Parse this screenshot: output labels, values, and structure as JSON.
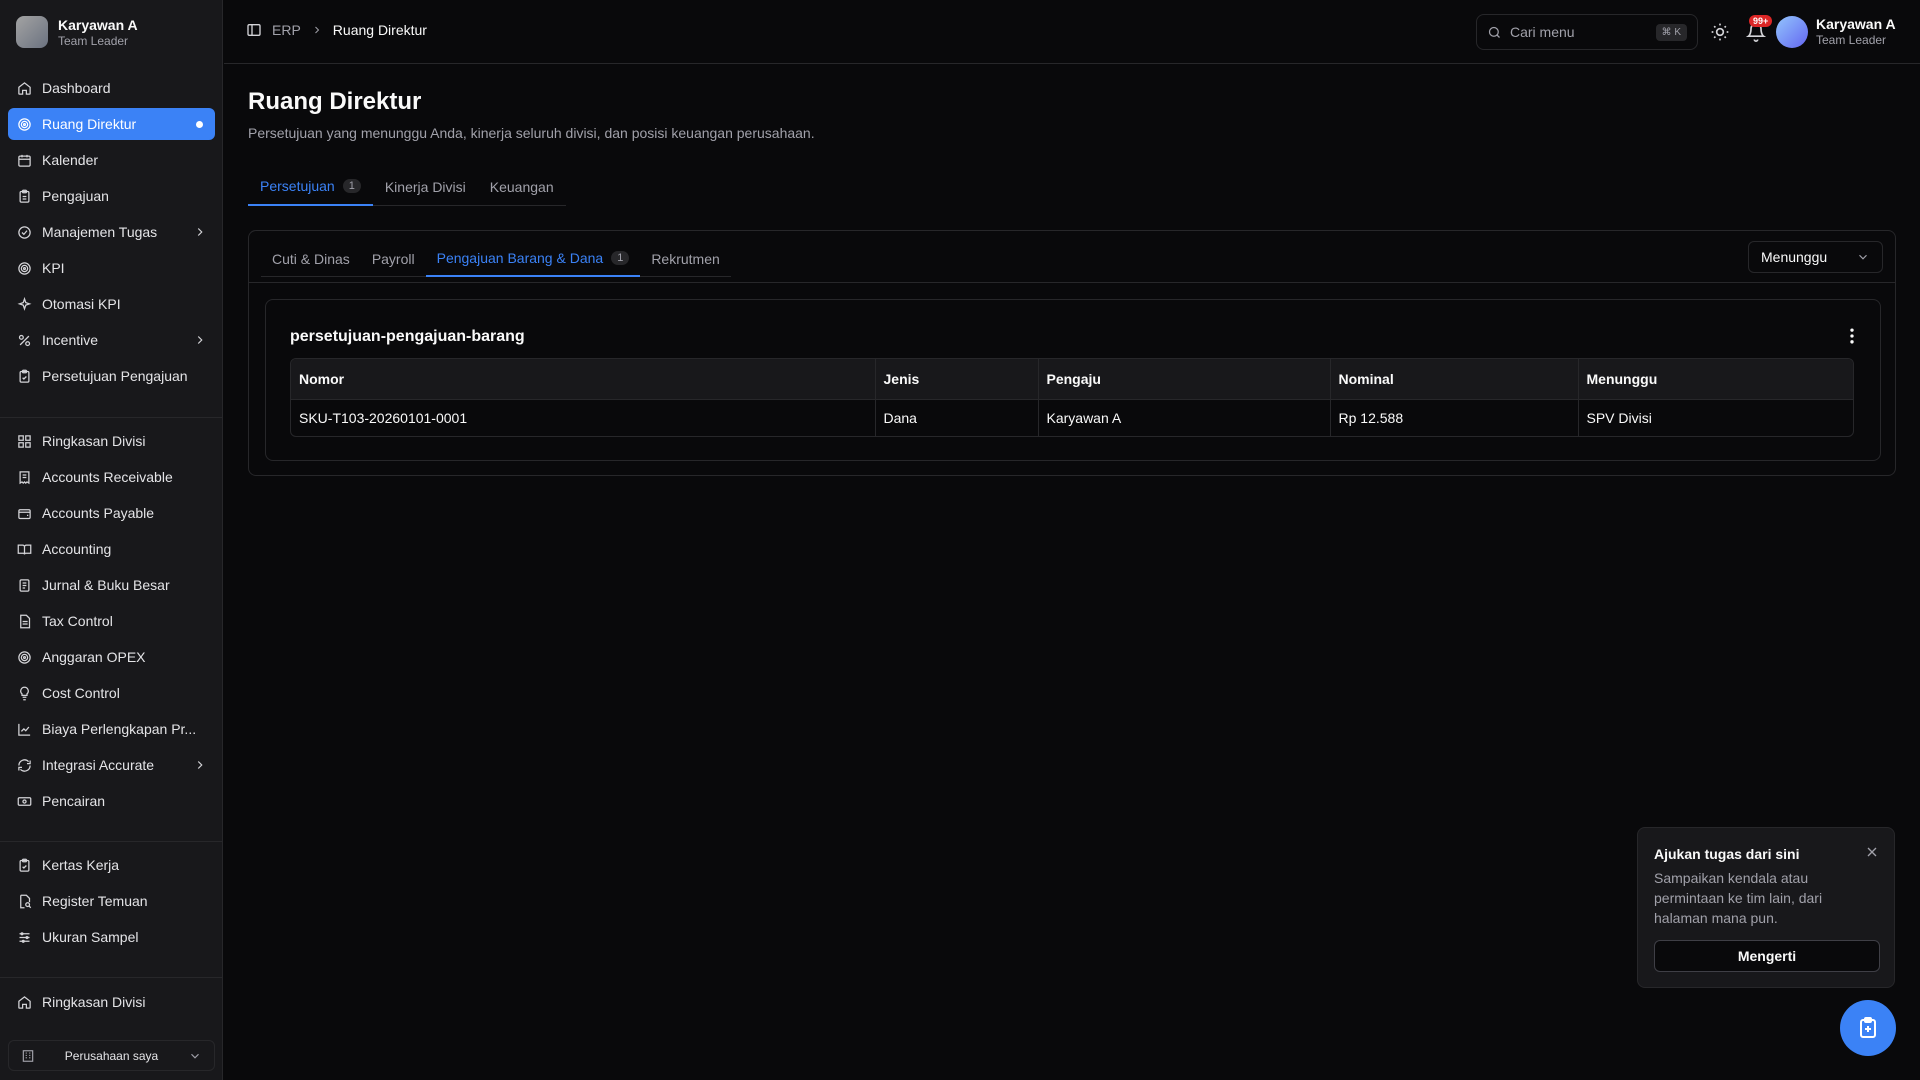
{
  "user": {
    "name": "Karyawan A",
    "role": "Team Leader"
  },
  "sidebar": {
    "group1": [
      {
        "label": "Dashboard",
        "icon": "home-icon"
      },
      {
        "label": "Ruang Direktur",
        "icon": "target-icon",
        "active": true
      },
      {
        "label": "Kalender",
        "icon": "calendar-icon"
      },
      {
        "label": "Pengajuan",
        "icon": "clipboard-icon"
      },
      {
        "label": "Manajemen Tugas",
        "icon": "tasks-icon",
        "chevron": true
      },
      {
        "label": "KPI",
        "icon": "target-icon"
      },
      {
        "label": "Otomasi KPI",
        "icon": "sparkle-icon"
      },
      {
        "label": "Incentive",
        "icon": "percent-icon",
        "chevron": true
      },
      {
        "label": "Persetujuan Pengajuan",
        "icon": "clipboard-check-icon"
      }
    ],
    "group2": [
      {
        "label": "Ringkasan Divisi",
        "icon": "grid-icon"
      },
      {
        "label": "Accounts Receivable",
        "icon": "receipt-icon"
      },
      {
        "label": "Accounts Payable",
        "icon": "wallet-icon"
      },
      {
        "label": "Accounting",
        "icon": "book-icon"
      },
      {
        "label": "Jurnal & Buku Besar",
        "icon": "ledger-icon"
      },
      {
        "label": "Tax Control",
        "icon": "file-text-icon"
      },
      {
        "label": "Anggaran OPEX",
        "icon": "target-icon"
      },
      {
        "label": "Cost Control",
        "icon": "lightbulb-icon"
      },
      {
        "label": "Biaya Perlengkapan Pr...",
        "icon": "chart-icon"
      },
      {
        "label": "Integrasi Accurate",
        "icon": "refresh-icon",
        "chevron": true
      },
      {
        "label": "Pencairan",
        "icon": "banknote-icon"
      }
    ],
    "group3": [
      {
        "label": "Kertas Kerja",
        "icon": "clipboard-icon"
      },
      {
        "label": "Register Temuan",
        "icon": "search-file-icon"
      },
      {
        "label": "Ukuran Sampel",
        "icon": "sliders-icon"
      }
    ],
    "group4": [
      {
        "label": "Ringkasan Divisi",
        "icon": "home-icon"
      }
    ],
    "company": "Perusahaan saya"
  },
  "header": {
    "breadcrumb": [
      "ERP",
      "Ruang Direktur"
    ],
    "search_placeholder": "Cari menu",
    "search_kbd": "⌘ K",
    "notif_badge": "99+"
  },
  "page": {
    "title": "Ruang Direktur",
    "subtitle": "Persetujuan yang menunggu Anda, kinerja seluruh divisi, dan posisi keuangan perusahaan."
  },
  "tabs_main": [
    {
      "label": "Persetujuan",
      "count": "1",
      "active": true
    },
    {
      "label": "Kinerja Divisi"
    },
    {
      "label": "Keuangan"
    }
  ],
  "tabs_sub": [
    {
      "label": "Cuti & Dinas"
    },
    {
      "label": "Payroll"
    },
    {
      "label": "Pengajuan Barang & Dana",
      "count": "1",
      "active": true
    },
    {
      "label": "Rekrutmen"
    }
  ],
  "status_filter": "Menunggu",
  "card": {
    "title": "persetujuan-pengajuan-barang",
    "columns": [
      "Nomor",
      "Jenis",
      "Pengaju",
      "Nominal",
      "Menunggu"
    ],
    "rows": [
      [
        "SKU-T103-20260101-0001",
        "Dana",
        "Karyawan A",
        "Rp 12.588",
        "SPV Divisi"
      ]
    ]
  },
  "toast": {
    "title": "Ajukan tugas dari sini",
    "body": "Sampaikan kendala atau permintaan ke tim lain, dari halaman mana pun.",
    "button": "Mengerti"
  },
  "colors": {
    "accent": "#3b82f6",
    "background": "#09090b",
    "sidebar": "#18181b",
    "badge": "#dc2626"
  }
}
